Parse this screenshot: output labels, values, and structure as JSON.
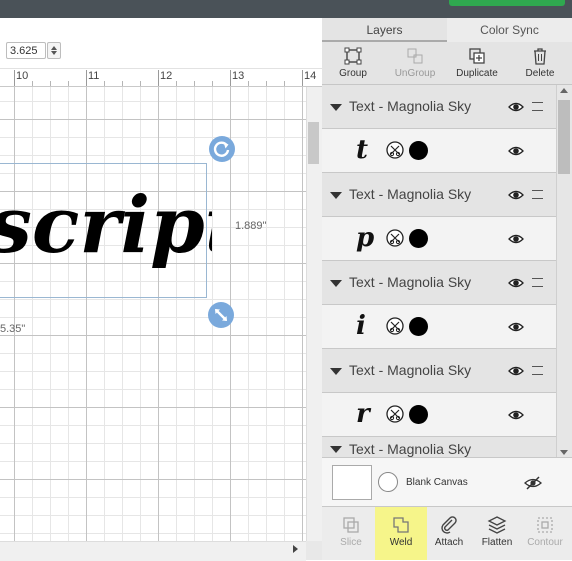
{
  "toolbar": {
    "size_value": "3.625"
  },
  "ruler": {
    "labels": [
      "10",
      "11",
      "12",
      "13",
      "14"
    ]
  },
  "canvas": {
    "text_content": "script",
    "height_label": "1.889\"",
    "width_label": "5.35\""
  },
  "panel": {
    "tabs": [
      "Layers",
      "Color Sync"
    ],
    "tools": [
      {
        "label": "Group",
        "icon": "group-icon"
      },
      {
        "label": "UnGroup",
        "icon": "ungroup-icon"
      },
      {
        "label": "Duplicate",
        "icon": "duplicate-icon"
      },
      {
        "label": "Delete",
        "icon": "trash-icon"
      }
    ],
    "layers": [
      {
        "name": "Text - Magnolia Sky",
        "letter": "t"
      },
      {
        "name": "Text - Magnolia Sky",
        "letter": "p"
      },
      {
        "name": "Text - Magnolia Sky",
        "letter": "i"
      },
      {
        "name": "Text - Magnolia Sky",
        "letter": "r"
      },
      {
        "name": "Text - Magnolia Sky"
      }
    ],
    "blank_canvas_label": "Blank Canvas",
    "bottom_tools": [
      {
        "label": "Slice",
        "icon": "slice-icon"
      },
      {
        "label": "Weld",
        "icon": "weld-icon"
      },
      {
        "label": "Attach",
        "icon": "attach-icon"
      },
      {
        "label": "Flatten",
        "icon": "flatten-icon"
      },
      {
        "label": "Contour",
        "icon": "contour-icon"
      }
    ]
  },
  "colors": {
    "accent_green": "#2fa84f",
    "handle_blue": "#7aa9dc",
    "weld_highlight": "#f6f58a"
  }
}
